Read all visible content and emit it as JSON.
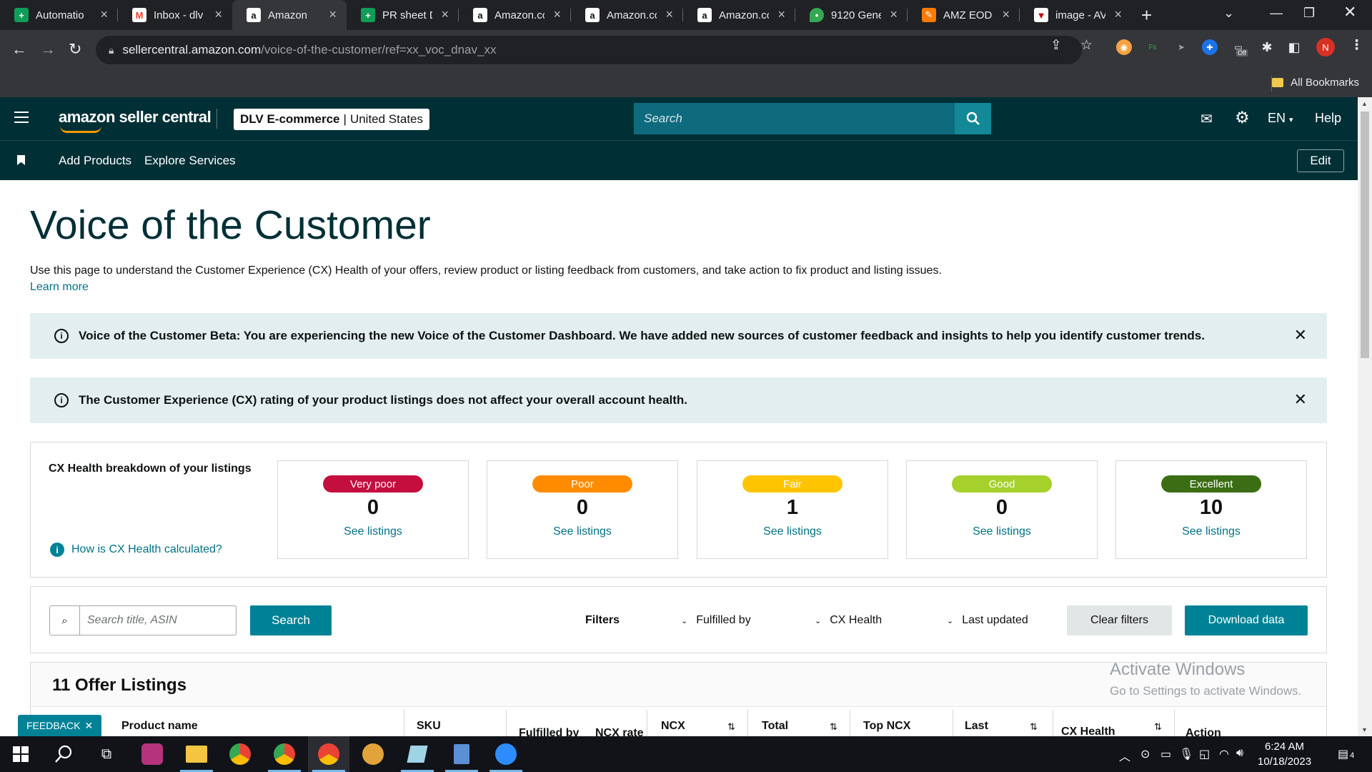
{
  "browser": {
    "tabs": [
      {
        "title": "Automatio",
        "icon": "sheets-icon",
        "active": false
      },
      {
        "title": "Inbox - dlv",
        "icon": "gmail-icon",
        "active": false
      },
      {
        "title": "Amazon",
        "icon": "amazon-icon",
        "active": true
      },
      {
        "title": "PR sheet D",
        "icon": "sheets-icon",
        "active": false
      },
      {
        "title": "Amazon.co",
        "icon": "amazon-icon",
        "active": false
      },
      {
        "title": "Amazon.co",
        "icon": "amazon-icon",
        "active": false
      },
      {
        "title": "Amazon.co",
        "icon": "amazon-icon",
        "active": false
      },
      {
        "title": "9120 Gene",
        "icon": "maps-icon",
        "active": false
      },
      {
        "title": "AMZ EOD",
        "icon": "amz-eod-icon",
        "active": false
      },
      {
        "title": "image - AV",
        "icon": "aws-icon",
        "active": false
      }
    ],
    "url_host": "sellercentral.amazon.com",
    "url_path": "/voice-of-the-customer/ref=xx_voc_dnav_xx",
    "profile_initial": "N",
    "extension_badge": "Off",
    "bookmarks_label": "All Bookmarks"
  },
  "header": {
    "logo_text": "amazon seller central",
    "store_name": "DLV E-commerce",
    "store_region": "United States",
    "search_placeholder": "Search",
    "language": "EN",
    "help": "Help"
  },
  "subnav": {
    "links": [
      "Add Products",
      "Explore Services"
    ],
    "edit": "Edit"
  },
  "main": {
    "title": "Voice of the Customer",
    "description": "Use this page to understand the Customer Experience (CX) Health of your offers, review product or listing feedback from customers, and take action to fix product and listing issues.",
    "learn_more": "Learn more",
    "alerts": [
      "Voice of the Customer Beta: You are experiencing the new Voice of the Customer Dashboard. We have added new sources of customer feedback and insights to help you identify customer trends.",
      "The Customer Experience (CX) rating of your product listings does not affect your overall account health."
    ],
    "cx_health": {
      "heading": "CX Health breakdown of your listings",
      "how_link": "How is CX Health calculated?",
      "see_listings": "See listings",
      "ratings": [
        {
          "label": "Very poor",
          "count": "0",
          "color": "#c40f3e"
        },
        {
          "label": "Poor",
          "count": "0",
          "color": "#ff8c00"
        },
        {
          "label": "Fair",
          "count": "1",
          "color": "#ffc400"
        },
        {
          "label": "Good",
          "count": "0",
          "color": "#a6d12c"
        },
        {
          "label": "Excellent",
          "count": "10",
          "color": "#3b6e14"
        }
      ]
    },
    "filters": {
      "search_placeholder": "Search title, ASIN",
      "search_button": "Search",
      "filters_label": "Filters",
      "dropdowns": [
        "Fulfilled by",
        "CX Health",
        "Last updated"
      ],
      "clear": "Clear filters",
      "download": "Download data"
    },
    "listings": {
      "title": "11 Offer Listings",
      "columns": [
        "Product name",
        "SKU",
        "Fulfilled by",
        "NCX rate",
        "NCX",
        "Total",
        "Top NCX",
        "Last",
        "CX Health",
        "Action"
      ]
    },
    "feedback": "FEEDBACK"
  },
  "watermark": {
    "line1": "Activate Windows",
    "line2": "Go to Settings to activate Windows."
  },
  "taskbar": {
    "time": "6:24 AM",
    "date": "10/18/2023",
    "notifications": "4"
  }
}
